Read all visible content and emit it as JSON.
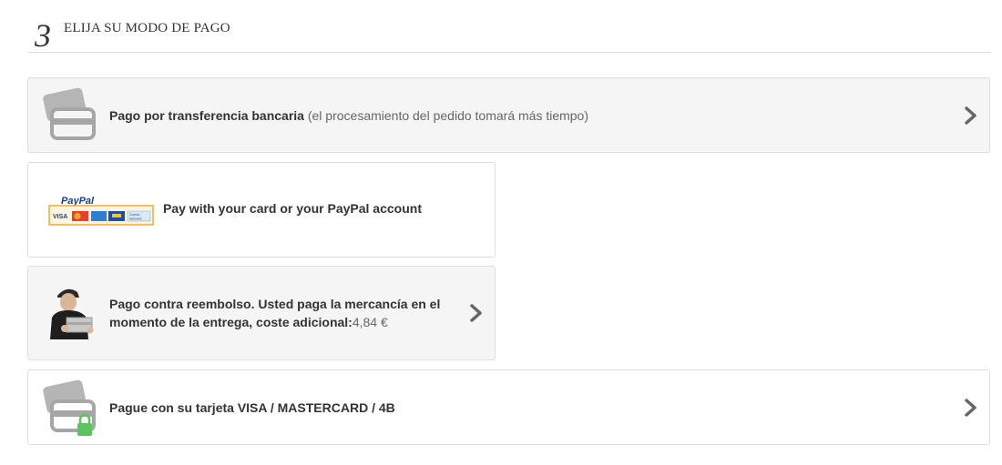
{
  "step": {
    "number": "3",
    "title": "ELIJA SU MODO DE PAGO"
  },
  "payment_options": [
    {
      "id": "bank-transfer",
      "label": "Pago por transferencia bancaria",
      "note": "(el procesamiento del pedido tomará más tiempo)",
      "icon": "credit-card-icon"
    },
    {
      "id": "paypal",
      "label": "Pay with your card or your PayPal account",
      "icon": "paypal-logo",
      "logo_text": "PayPal",
      "logo_cards": [
        "VISA",
        "MasterCard",
        "AMEX",
        "Maestro",
        "Cuenta bancaria"
      ]
    },
    {
      "id": "cash-on-delivery",
      "label": "Pago contra reembolso. Usted paga la mercancía en el momento de la entrega, coste adicional:",
      "price": "4,84 €",
      "icon": "delivery-man-icon"
    },
    {
      "id": "card",
      "label": "Pague con su tarjeta VISA / MASTERCARD / 4B",
      "icon": "secure-card-icon"
    }
  ],
  "colors": {
    "option_bg": "#f5f5f5",
    "border": "#dedede",
    "icon_grey": "#a6a6a6",
    "lock_green": "#5cc45c",
    "paypal_blue": "#1a3f8f"
  }
}
